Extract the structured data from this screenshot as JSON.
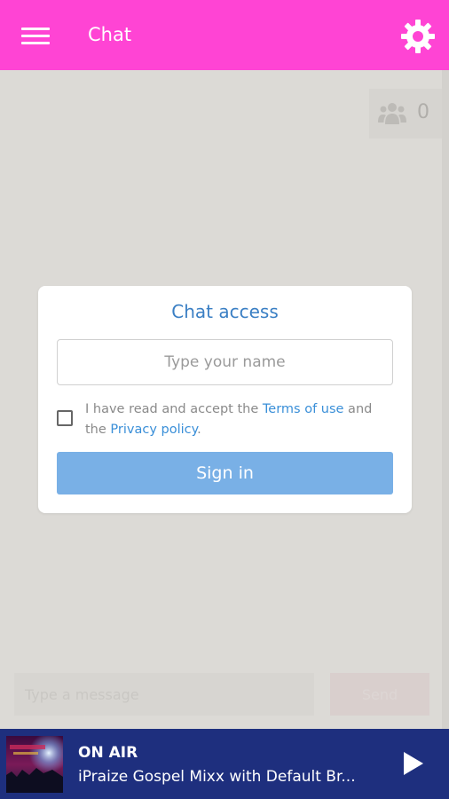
{
  "header": {
    "title": "Chat",
    "menu_icon": "hamburger-menu-icon",
    "settings_icon": "gear-icon",
    "color": "#ff44d4"
  },
  "users_badge": {
    "icon": "group-icon",
    "count": "0"
  },
  "chat_access": {
    "title": "Chat access",
    "name_placeholder": "Type your name",
    "name_value": "",
    "terms_prefix": "I have read and accept the ",
    "terms_link": "Terms of use",
    "terms_middle": " and the ",
    "privacy_link": "Privacy policy",
    "terms_suffix": ".",
    "signin_label": "Sign in",
    "accent": "#3a7fc4",
    "button_color": "#79b0e6"
  },
  "composer": {
    "placeholder": "Type a message",
    "send_label": "Send"
  },
  "player": {
    "status": "ON AIR",
    "track": "iPraize Gospel Mixx with Default Br...",
    "play_icon": "play-icon",
    "color": "#1e2f7e"
  }
}
